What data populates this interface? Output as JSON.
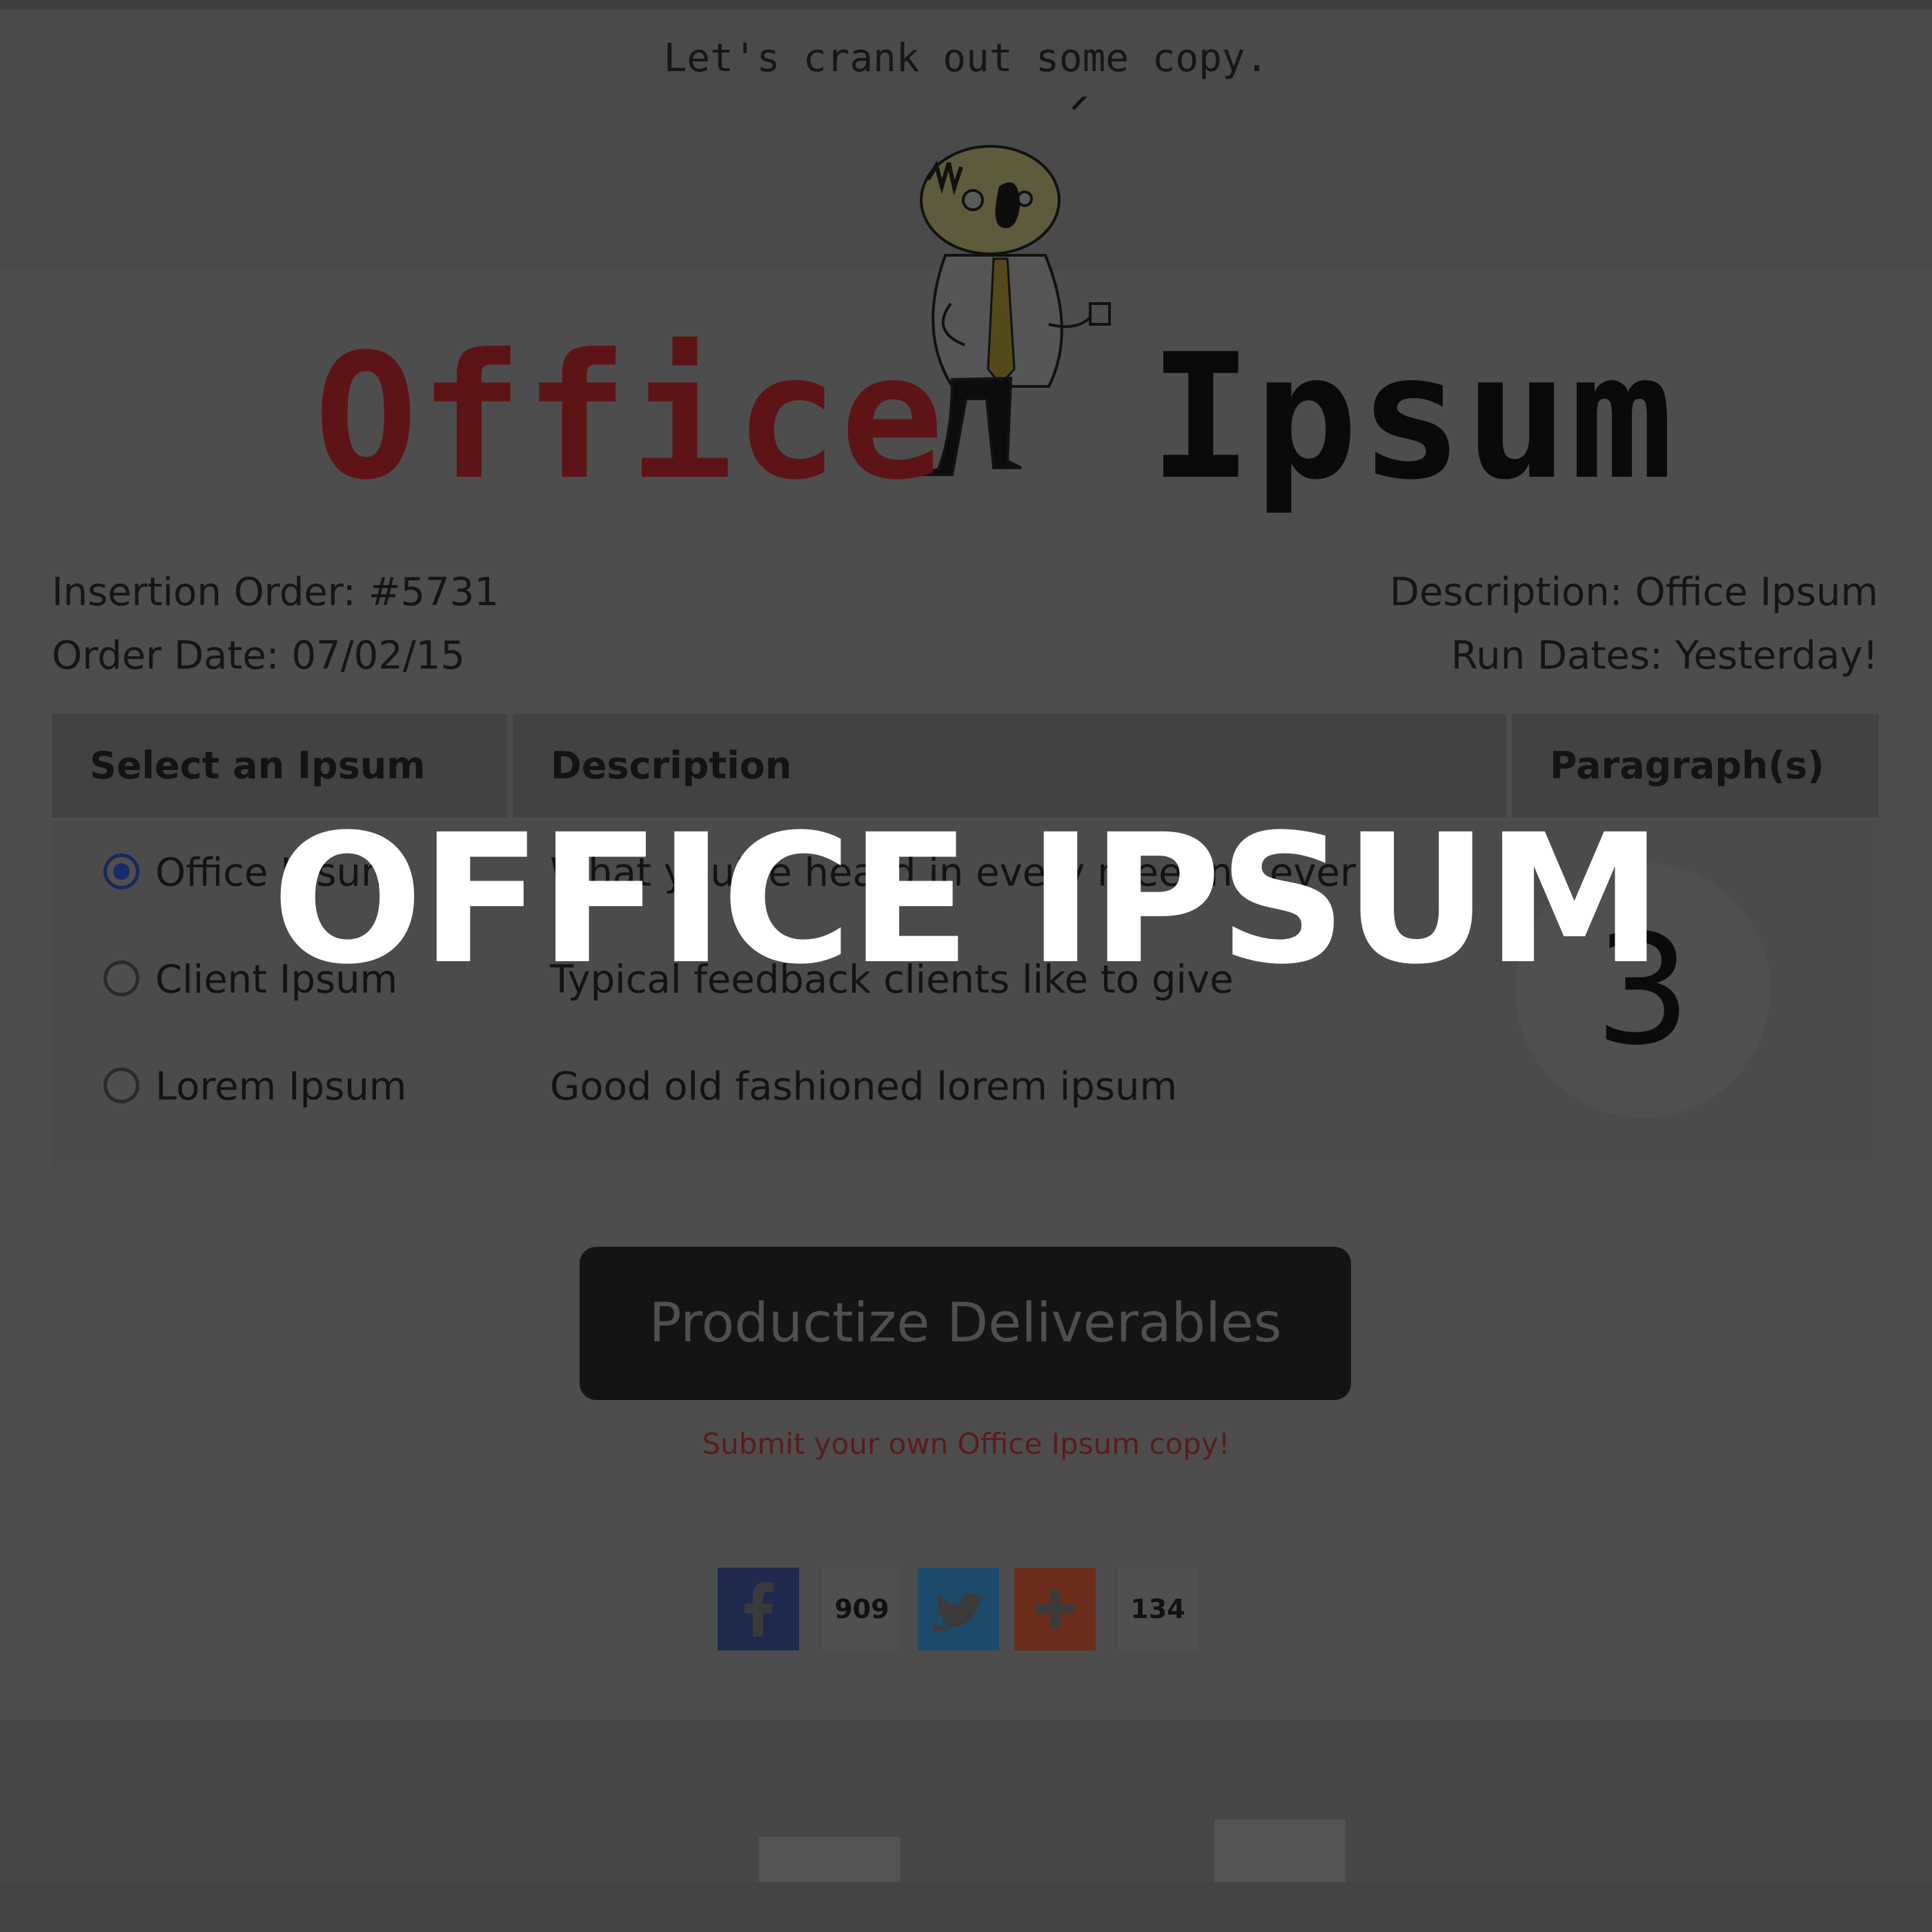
{
  "speech_bubble": "Let's crank out some copy.",
  "logo": {
    "word1": "Office",
    "word2": "Ipsum"
  },
  "order": {
    "insertion": "Insertion Order: #5731",
    "date": "Order Date: 07/02/15",
    "description": "Description: Office Ipsum",
    "run_dates": "Run Dates: Yesterday!"
  },
  "table": {
    "headers": [
      "Select an Ipsum",
      "Description",
      "Paragraph(s)"
    ],
    "rows": [
      {
        "label": "Office Ipsum",
        "description": "What you've heard in every meeting ever",
        "selected": true
      },
      {
        "label": "Client Ipsum",
        "description": "Typical feedback clients like to give",
        "selected": false
      },
      {
        "label": "Lorem Ipsum",
        "description": "Good old fashioned lorem ipsum",
        "selected": false
      }
    ],
    "paragraphs": "3"
  },
  "cta_label": "Productize Deliverables",
  "submit_link": "Submit your own Office Ipsum copy!",
  "social": {
    "facebook_count": "909",
    "plus_count": "134"
  },
  "overlay_title": "OFFICE IPSUM",
  "colors": {
    "logo_office": "#5e1416",
    "radio_selected": "#182b6b",
    "facebook": "#1f2a4f",
    "twitter": "#1b4a6a",
    "plus": "#6a2d1c"
  }
}
